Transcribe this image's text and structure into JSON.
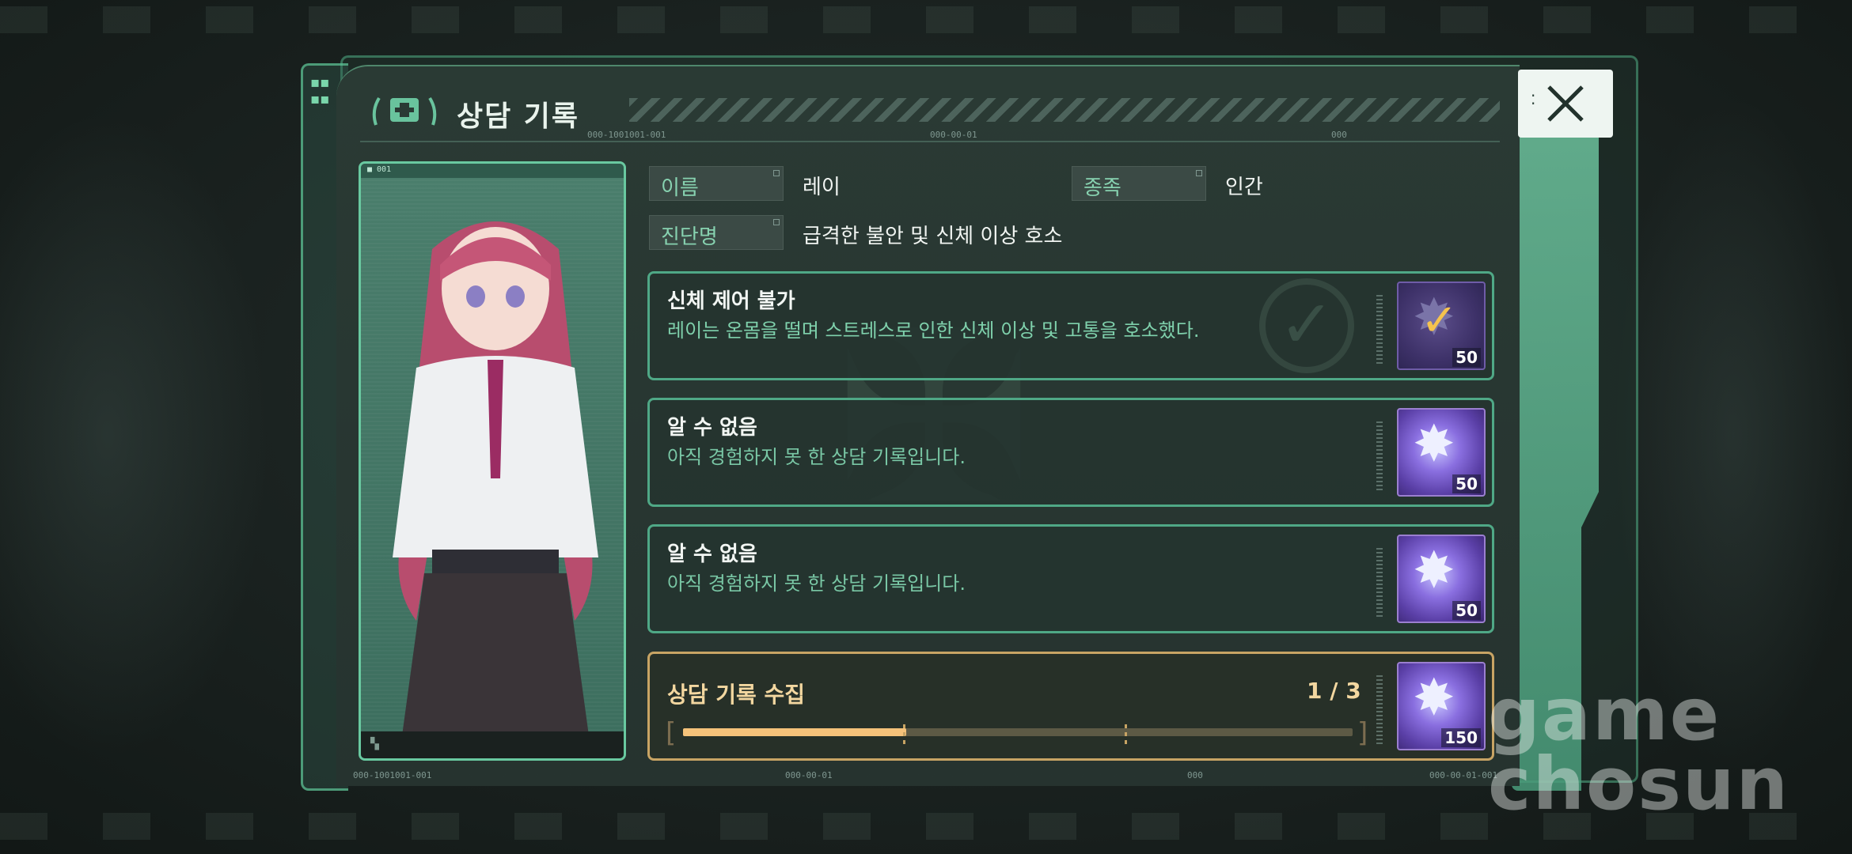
{
  "window": {
    "title": "상담 기록",
    "code_top_left": "000-1001001-001",
    "code_top_mid": "000-00-01",
    "code_top_right": "000",
    "code_bottom_left": "000-1001001-001",
    "code_bottom_mid": "000-00-01",
    "code_bottom_right": "000",
    "code_bottom_far": "000-00-01-001"
  },
  "portrait": {
    "tag": "■ 001",
    "alt": "레이"
  },
  "profile": {
    "name_label": "이름",
    "name_value": "레이",
    "species_label": "종족",
    "species_value": "인간",
    "diagnosis_label": "진단명",
    "diagnosis_value": "급격한 불안 및 신체 이상 호소"
  },
  "records": [
    {
      "title": "신체 제어 불가",
      "description": "레이는 온몸을 떨며 스트레스로 인한 신체 이상 및 고통을 호소했다.",
      "reward_qty": "50",
      "completed": true
    },
    {
      "title": "알 수 없음",
      "description": "아직 경험하지 못 한 상담 기록입니다.",
      "reward_qty": "50",
      "completed": false
    },
    {
      "title": "알 수 없음",
      "description": "아직 경험하지 못 한 상담 기록입니다.",
      "reward_qty": "50",
      "completed": false
    }
  ],
  "collection": {
    "title": "상담 기록 수집",
    "count_text": "1 / 3",
    "progress": 0.333,
    "reward_qty": "150"
  },
  "watermark": {
    "line1": "game",
    "line2": "chosun"
  },
  "colors": {
    "accent": "#69c9a0",
    "gold": "#c8a464",
    "progress_fill": "#f5c27a",
    "check": "#f5c34e"
  },
  "icons": [
    "close-icon",
    "emblem-icon",
    "star-crystal-icon",
    "checkmark-icon"
  ]
}
